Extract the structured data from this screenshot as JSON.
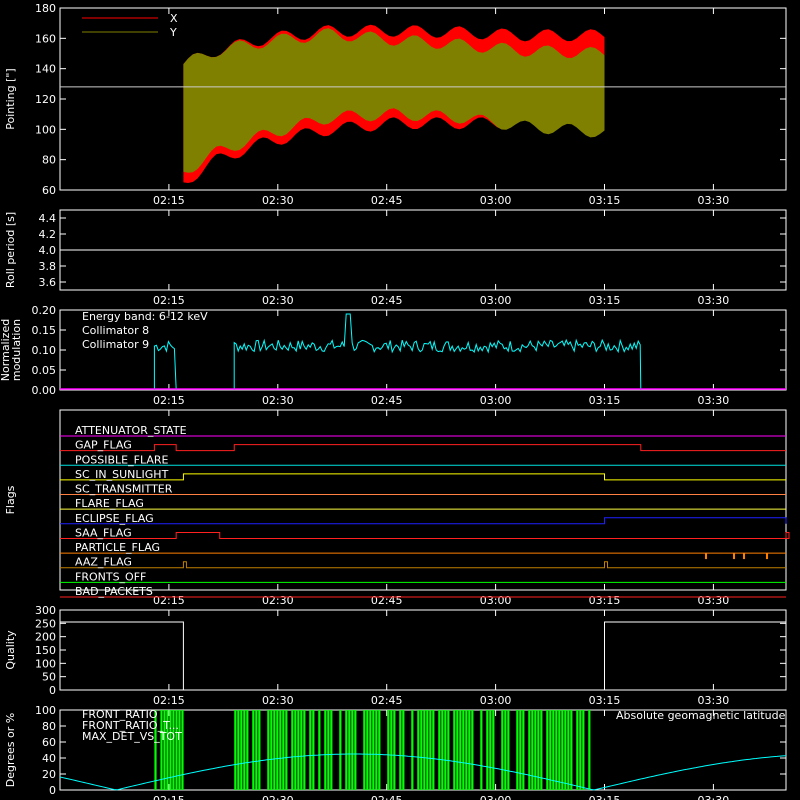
{
  "time_ticks": [
    "02:15",
    "02:30",
    "02:45",
    "03:00",
    "03:15",
    "03:30"
  ],
  "chart_data": [
    {
      "type": "area",
      "ylabel": "Pointing [\"]",
      "ylim": [
        60,
        180
      ],
      "yticks": [
        60,
        80,
        100,
        120,
        140,
        160,
        180
      ],
      "hline": 128,
      "legend": [
        {
          "name": "X",
          "color": "#ff0000"
        },
        {
          "name": "Y",
          "color": "#808000"
        }
      ],
      "series": [
        {
          "name": "X",
          "color": "#ff0000",
          "t_start": "02:17",
          "t_end": "03:15",
          "upper": [
            [
              0,
              143
            ],
            [
              0.08,
              152
            ],
            [
              0.2,
              160
            ],
            [
              0.35,
              165
            ],
            [
              0.5,
              165
            ],
            [
              0.65,
              164
            ],
            [
              0.8,
              162
            ],
            [
              1,
              162
            ]
          ],
          "lower": [
            [
              0,
              65
            ],
            [
              0.08,
              80
            ],
            [
              0.2,
              92
            ],
            [
              0.35,
              100
            ],
            [
              0.5,
              104
            ],
            [
              0.65,
              104
            ],
            [
              0.8,
              104
            ],
            [
              1,
              104
            ]
          ]
        },
        {
          "name": "Y",
          "color": "#808000",
          "t_start": "02:17",
          "t_end": "03:15",
          "upper": [
            [
              0,
              143
            ],
            [
              0.08,
              152
            ],
            [
              0.2,
              158
            ],
            [
              0.35,
              163
            ],
            [
              0.5,
              159
            ],
            [
              0.65,
              156
            ],
            [
              0.8,
              152
            ],
            [
              1,
              150
            ]
          ],
          "lower": [
            [
              0,
              72
            ],
            [
              0.08,
              85
            ],
            [
              0.2,
              97
            ],
            [
              0.35,
              108
            ],
            [
              0.5,
              110
            ],
            [
              0.65,
              108
            ],
            [
              0.8,
              102
            ],
            [
              1,
              98
            ]
          ]
        }
      ]
    },
    {
      "type": "line",
      "ylabel": "Roll period [s]",
      "ylim": [
        3.5,
        4.5
      ],
      "yticks": [
        "3.6",
        "3.8",
        "4.0",
        "4.2",
        "4.4"
      ],
      "value": 4.0
    },
    {
      "type": "line",
      "ylabel": "Normalized modulation",
      "ylim": [
        0,
        0.2
      ],
      "yticks": [
        "0.00",
        "0.05",
        "0.10",
        "0.15",
        "0.20"
      ],
      "annotation": "Energy band: 6-12 keV",
      "series": [
        {
          "name": "Collimator 8",
          "color": "#00ffff",
          "segments": [
            [
              "02:13",
              "02:16",
              0.11
            ],
            [
              "02:24",
              "03:20",
              0.11
            ]
          ]
        },
        {
          "name": "Collimator 9",
          "color": "#ff00ff",
          "value": 0.0
        }
      ]
    },
    {
      "type": "line",
      "ylabel": "Flags",
      "flags": [
        {
          "name": "ATTENUATOR_STATE",
          "color": "#ff00ff",
          "steps": []
        },
        {
          "name": "GAP_FLAG",
          "color": "#ff2020",
          "steps": [
            [
              "02:13",
              "02:16"
            ],
            [
              "02:24",
              "03:20"
            ]
          ]
        },
        {
          "name": "POSSIBLE_FLARE",
          "color": "#00e0e0",
          "steps": []
        },
        {
          "name": "SC_IN_SUNLIGHT",
          "color": "#ffff00",
          "steps": [
            [
              "02:17",
              "03:15"
            ]
          ],
          "inverse": true
        },
        {
          "name": "SC_TRANSMITTER",
          "color": "#ff8040",
          "steps": []
        },
        {
          "name": "FLARE_FLAG",
          "color": "#ffff40",
          "steps": []
        },
        {
          "name": "ECLIPSE_FLAG",
          "color": "#2020ff",
          "steps": [
            [
              "03:15",
              "03:40"
            ]
          ]
        },
        {
          "name": "SAA_FLAG",
          "color": "#ff2020",
          "steps": [
            [
              "02:16",
              "02:22"
            ],
            [
              "03:40",
              "03:40"
            ]
          ]
        },
        {
          "name": "PARTICLE_FLAG",
          "color": "#ff8000",
          "steps": [],
          "note": "I"
        },
        {
          "name": "AAZ_FLAG",
          "color": "#c08000",
          "steps": [
            [
              "02:17",
              "02:17"
            ],
            [
              "03:15",
              "03:15"
            ]
          ]
        },
        {
          "name": "FRONTS_OFF",
          "color": "#00ff00",
          "steps": []
        },
        {
          "name": "BAD_PACKETS",
          "color": "#ff2020",
          "steps": []
        }
      ]
    },
    {
      "type": "line",
      "ylabel": "Quality",
      "ylim": [
        0,
        300
      ],
      "yticks": [
        "0",
        "50",
        "100",
        "150",
        "200",
        "250",
        "300"
      ],
      "segments": [
        [
          "02:00",
          "02:17",
          255
        ],
        [
          "02:17",
          "03:15",
          0
        ],
        [
          "03:15",
          "03:40",
          255
        ]
      ]
    },
    {
      "type": "bar",
      "ylabel": "Degrees or %",
      "ylim": [
        0,
        100
      ],
      "yticks": [
        "0",
        "20",
        "40",
        "60",
        "80",
        "100"
      ],
      "legend": [
        {
          "name": "FRONT_RATIO",
          "color": "#ffff00"
        },
        {
          "name": "FRONT_RATIO_T...",
          "color": "#00ff00"
        },
        {
          "name": "MAX_DET_VS_TOT",
          "color": "#ff8000"
        }
      ],
      "right_label": "Absolute geomagnetic latitude",
      "right_label_color": "#00ffff"
    }
  ]
}
